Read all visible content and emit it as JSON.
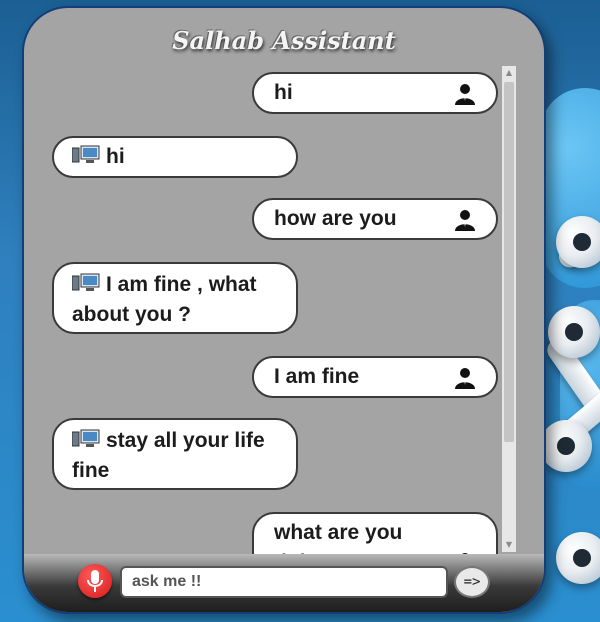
{
  "app": {
    "title": "Salhab Assistant"
  },
  "messages": [
    {
      "sender": "user",
      "text": "hi"
    },
    {
      "sender": "bot",
      "text": "hi"
    },
    {
      "sender": "user",
      "text": "how are you"
    },
    {
      "sender": "bot",
      "text": "I am fine , what about you ?"
    },
    {
      "sender": "user",
      "text": "I am fine"
    },
    {
      "sender": "bot",
      "text": "stay all your life fine"
    },
    {
      "sender": "user",
      "text": "what are you doing"
    }
  ],
  "input": {
    "placeholder": "ask me !!",
    "value": ""
  },
  "send": {
    "label": "=>"
  },
  "icons": {
    "user": "user-silhouette-icon",
    "bot": "computer-icon",
    "mic": "microphone-icon"
  },
  "colors": {
    "panel": "#a4a4a4",
    "bubble": "#ffffff",
    "mic": "#e02020",
    "background": "#2a8fd0"
  }
}
